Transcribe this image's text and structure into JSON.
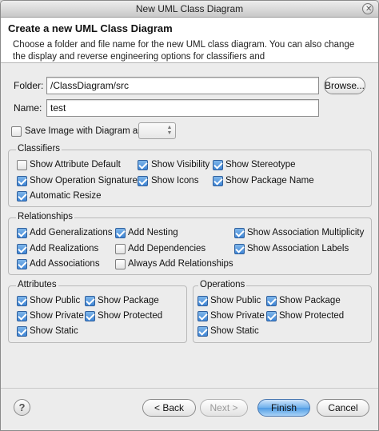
{
  "window": {
    "title": "New UML Class Diagram"
  },
  "header": {
    "title": "Create a new UML Class Diagram",
    "description": "Choose a folder and file name for the new UML class diagram. You can also change the display and reverse engineering options for classifiers and"
  },
  "form": {
    "folder_label": "Folder:",
    "folder_value": "/ClassDiagram/src",
    "browse_label": "Browse...",
    "name_label": "Name:",
    "name_value": "test",
    "save_image": {
      "label": "Save Image with Diagram as",
      "checked": false
    }
  },
  "classifiers": {
    "title": "Classifiers",
    "options": [
      {
        "label": "Show Attribute Default",
        "checked": false
      },
      {
        "label": "Show Visibility",
        "checked": true
      },
      {
        "label": "Show Stereotype",
        "checked": true
      },
      {
        "label": "Show Operation Signature",
        "checked": true
      },
      {
        "label": "Show Icons",
        "checked": true
      },
      {
        "label": "Show Package Name",
        "checked": true
      },
      {
        "label": "Automatic Resize",
        "checked": true
      }
    ]
  },
  "relationships": {
    "title": "Relationships",
    "options": [
      {
        "label": "Add Generalizations",
        "checked": true
      },
      {
        "label": "Add Nesting",
        "checked": true
      },
      {
        "label": "Show Association Multiplicity",
        "checked": true
      },
      {
        "label": "Add Realizations",
        "checked": true
      },
      {
        "label": "Add Dependencies",
        "checked": false
      },
      {
        "label": "Show Association Labels",
        "checked": true
      },
      {
        "label": "Add Associations",
        "checked": true
      },
      {
        "label": "Always Add Relationships",
        "checked": false
      }
    ]
  },
  "attributes": {
    "title": "Attributes",
    "options": [
      {
        "label": "Show Public",
        "checked": true
      },
      {
        "label": "Show Package",
        "checked": true
      },
      {
        "label": "Show Private",
        "checked": true
      },
      {
        "label": "Show Protected",
        "checked": true
      },
      {
        "label": "Show Static",
        "checked": true
      }
    ]
  },
  "operations": {
    "title": "Operations",
    "options": [
      {
        "label": "Show Public",
        "checked": true
      },
      {
        "label": "Show Package",
        "checked": true
      },
      {
        "label": "Show Private",
        "checked": true
      },
      {
        "label": "Show Protected",
        "checked": true
      },
      {
        "label": "Show Static",
        "checked": true
      }
    ]
  },
  "buttons": {
    "help_symbol": "?",
    "back": "< Back",
    "next": "Next >",
    "finish": "Finish",
    "cancel": "Cancel"
  },
  "colors": {
    "check_fill": "#3f86d6",
    "primary_button": "#4f9be4"
  }
}
